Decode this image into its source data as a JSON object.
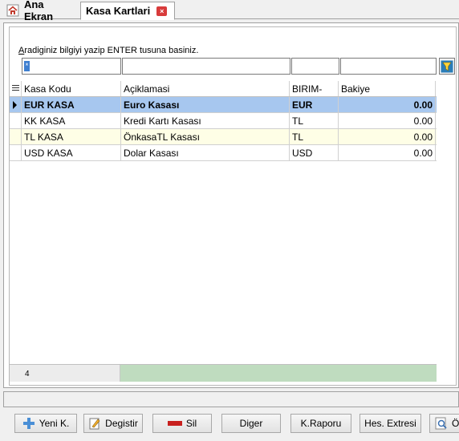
{
  "tabs": {
    "home_label": "Ana Ekran",
    "active_label": "Kasa Kartlari",
    "close_glyph": "×"
  },
  "filter": {
    "hint_prefix": "A",
    "hint_rest": "radiginiz bilgiyi yazip ENTER tusuna basiniz.",
    "star": "*"
  },
  "grid": {
    "headers": [
      "Kasa Kodu",
      "Açiklamasi",
      "BIRIM-",
      "Bakiye"
    ],
    "rows": [
      [
        "EUR KASA",
        "Euro Kasası",
        "EUR",
        "0.00"
      ],
      [
        "KK KASA",
        "Kredi Kartı Kasası",
        "TL",
        "0.00"
      ],
      [
        "TL KASA",
        "ÖnkasaTL Kasası",
        "TL",
        "0.00"
      ],
      [
        "USD KASA",
        "Dolar Kasası",
        "USD",
        "0.00"
      ]
    ],
    "record_count": "4"
  },
  "toolbar": {
    "new_label": "Yeni K.",
    "edit_label": "Degistir",
    "delete_label": "Sil",
    "other_label": "Diger",
    "report_label": "K.Raporu",
    "statement_label": "Hes. Extresi",
    "preview_label": "Ön"
  },
  "colors": {
    "selected_row": "#a7c7ef",
    "alt_row": "#fefee6",
    "count_bar": "#bfdcbf"
  }
}
